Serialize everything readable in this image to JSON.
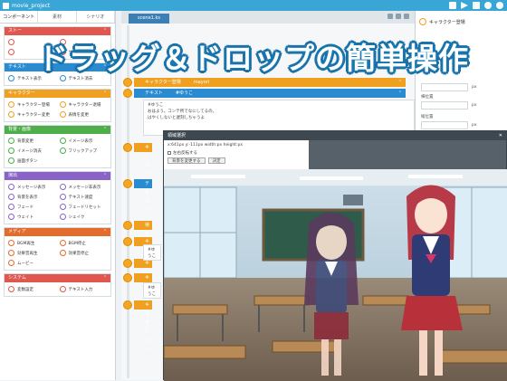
{
  "window": {
    "title": "movie_project"
  },
  "left": {
    "tabs": [
      {
        "label": "コンポーネント"
      },
      {
        "label": "素材"
      },
      {
        "label": "シナリオ"
      }
    ],
    "categories": [
      {
        "name": "ストー",
        "color": "#e0574f",
        "items": [
          "",
          "",
          "",
          "ゲーム終了"
        ]
      },
      {
        "name": "テキスト",
        "color": "#2b8bd0",
        "items": [
          "テキスト表示",
          "テキスト消去"
        ]
      },
      {
        "name": "キャラクター",
        "color": "#f0a020",
        "items": [
          "キャラクター登場",
          "キャラクター退場",
          "キャラクター変更",
          "表情を変更"
        ]
      },
      {
        "name": "背景・画像",
        "color": "#4eae4a",
        "items": [
          "背景変更",
          "イメージ表示",
          "イメージ消去",
          "フリックアップ",
          "画面ボタン"
        ]
      },
      {
        "name": "演出",
        "color": "#8a63c8",
        "items": [
          "メッセージ表示",
          "メッセージ非表示",
          "背景を表示",
          "テキスト速度",
          "フェード",
          "フェードリセット",
          "ウェイト",
          "シェイク"
        ]
      },
      {
        "name": "メディア",
        "color": "#e36b2c",
        "items": [
          "BGM再生",
          "BGM停止",
          "効果音再生",
          "効果音停止",
          "ムービー"
        ]
      },
      {
        "name": "システム",
        "color": "#e0574f",
        "items": [
          "変数設定",
          "テキスト入力"
        ]
      }
    ]
  },
  "middle": {
    "tab_label": "scene1.ks",
    "rows": [
      {
        "label": "キャラクター登場",
        "value": "mayori",
        "color": "#f0a020"
      },
      {
        "label": "テキスト",
        "value": "#ゆうこ",
        "color": "#2b8bd0"
      },
      {
        "label": "キャラクター",
        "color": "#f0a020"
      },
      {
        "label": "テキスト",
        "color": "#2b8bd0"
      },
      {
        "label": "キャラクター",
        "color": "#f0a020"
      },
      {
        "label": "待止",
        "color": "#f0a020"
      },
      {
        "label": "キャラクター",
        "color": "#f0a020"
      },
      {
        "label": "キャラクター",
        "color": "#f0a020"
      },
      {
        "label": "キャラクター",
        "color": "#f0a020"
      }
    ],
    "text_blocks": [
      "#ゆうこ\nおはよう。コンテ所でなにしてるの。\nはやくしないと遅刻しちゃうよ",
      "#ゆうこ\nよ",
      "#ゆうこ\nど"
    ]
  },
  "right": {
    "name_label": "キャラクター登場",
    "fields": [
      {
        "label": "",
        "unit": "px"
      },
      {
        "label": "横位置",
        "unit": "px"
      },
      {
        "label": "縦位置",
        "unit": "px"
      }
    ]
  },
  "dialog": {
    "title": "領域選択",
    "info": "x:641px y:-111px width:px height:px",
    "checkbox_label": "左右反転する",
    "buttons": [
      "背景を変更する",
      "決定"
    ]
  },
  "banner": {
    "text": "ドラッグ＆ドロップの簡単操作"
  },
  "colors": {
    "accent": "#3aa6d6",
    "banner_outline": "#1a6fa4"
  }
}
